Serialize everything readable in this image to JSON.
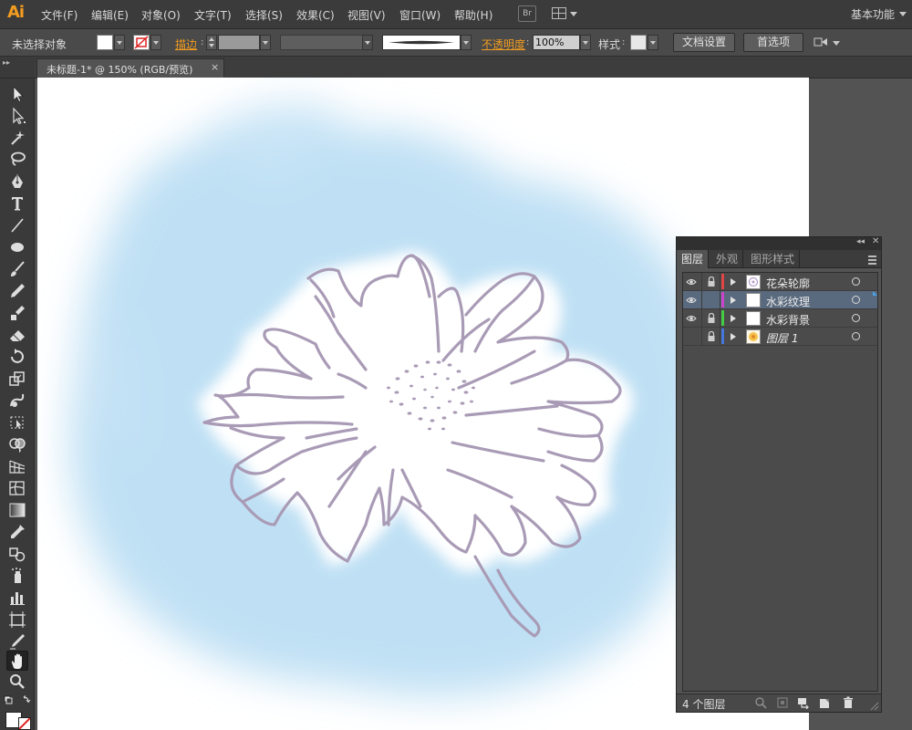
{
  "app": {
    "logo": "Ai",
    "menus": [
      "文件(F)",
      "编辑(E)",
      "对象(O)",
      "文字(T)",
      "选择(S)",
      "效果(C)",
      "视图(V)",
      "窗口(W)",
      "帮助(H)"
    ],
    "bridge_label": "Br",
    "workspace": "基本功能"
  },
  "control_bar": {
    "selection_status": "未选择对象",
    "stroke_label": "描边",
    "opacity_label": "不透明度",
    "opacity_value": "100%",
    "style_label": "样式",
    "doc_setup_button": "文档设置",
    "preferences_button": "首选项"
  },
  "document_tab": {
    "title": "未标题-1* @ 150% (RGB/预览)",
    "close": "×"
  },
  "tools": [
    "selection-tool-icon",
    "direct-selection-tool-icon",
    "magic-wand-tool-icon",
    "lasso-tool-icon",
    "pen-tool-icon",
    "type-tool-icon",
    "line-tool-icon",
    "ellipse-tool-icon",
    "paintbrush-tool-icon",
    "pencil-tool-icon",
    "blob-brush-tool-icon",
    "eraser-tool-icon",
    "rotate-tool-icon",
    "scale-tool-icon",
    "warp-tool-icon",
    "free-transform-tool-icon",
    "shape-builder-tool-icon",
    "perspective-grid-tool-icon",
    "mesh-tool-icon",
    "gradient-tool-icon",
    "eyedropper-tool-icon",
    "blend-tool-icon",
    "symbol-sprayer-tool-icon",
    "column-graph-tool-icon",
    "artboard-tool-icon",
    "slice-tool-icon",
    "hand-tool-icon",
    "zoom-tool-icon"
  ],
  "active_tool": "hand-tool-icon",
  "layers_panel": {
    "tabs": [
      "图层",
      "外观",
      "图形样式"
    ],
    "active_tab": "图层",
    "layers": [
      {
        "name": "花朵轮廓",
        "color": "#e04444",
        "visible": true,
        "locked": true,
        "selected": false,
        "italic": false,
        "thumb": "flower-outline-thumb"
      },
      {
        "name": "水彩纹理",
        "color": "#cc44cc",
        "visible": true,
        "locked": false,
        "selected": true,
        "italic": false,
        "thumb": "blank-thumb"
      },
      {
        "name": "水彩背景",
        "color": "#44cc44",
        "visible": true,
        "locked": true,
        "selected": false,
        "italic": false,
        "thumb": "blank-thumb"
      },
      {
        "name": "图层 1",
        "color": "#4477dd",
        "visible": false,
        "locked": true,
        "selected": false,
        "italic": true,
        "thumb": "flower-color-thumb"
      }
    ],
    "layer_count": "4 个图层"
  },
  "colors": {
    "accent_orange": "#f29c1f",
    "watercolor_blue": "#bfe0f4",
    "flower_outline": "#a99bb6"
  }
}
